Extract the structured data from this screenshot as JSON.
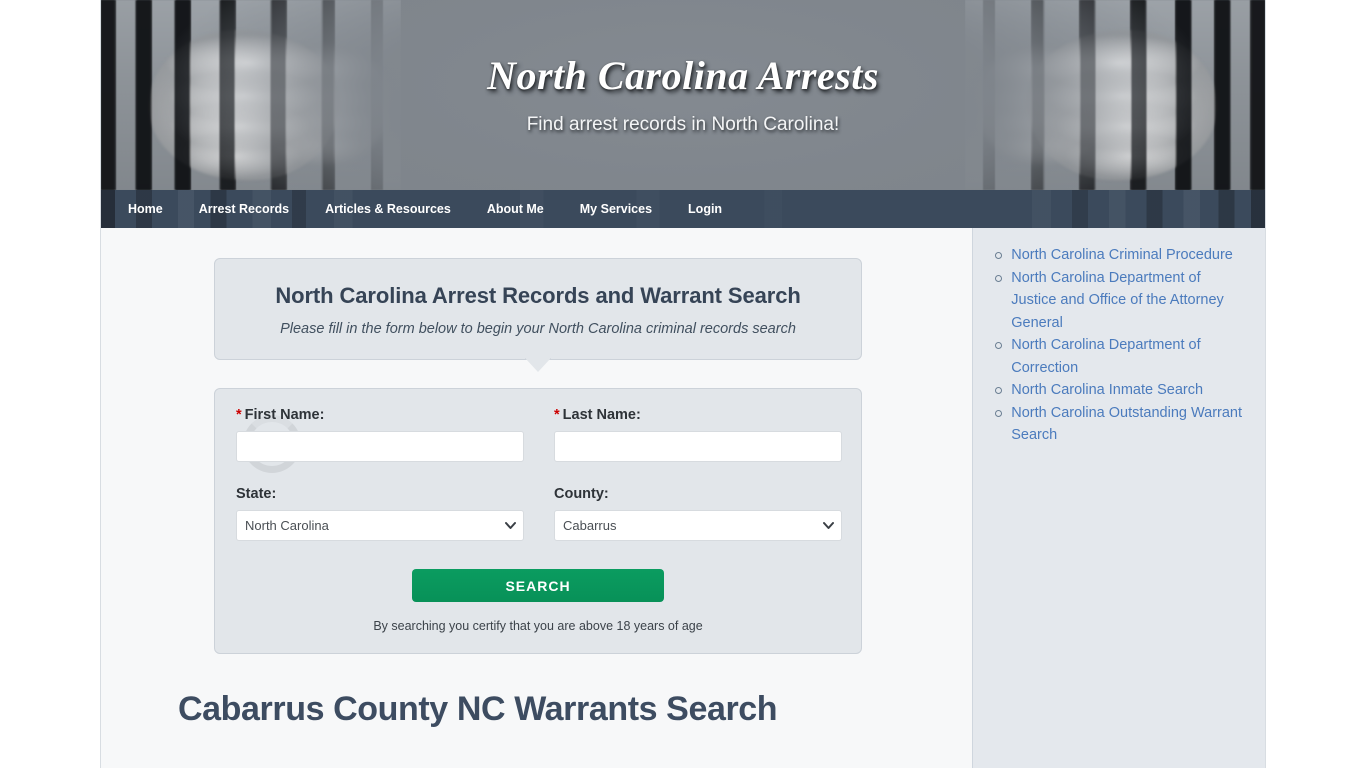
{
  "banner": {
    "title": "North Carolina Arrests",
    "tagline": "Find arrest records in North Carolina!",
    "image_alt": "hands-gripping-prison-bars"
  },
  "nav": {
    "items": [
      {
        "label": "Home"
      },
      {
        "label": "Arrest Records"
      },
      {
        "label": "Articles & Resources"
      },
      {
        "label": "About Me"
      },
      {
        "label": "My Services"
      },
      {
        "label": "Login"
      }
    ]
  },
  "intro": {
    "title": "North Carolina Arrest Records and Warrant Search",
    "subtitle": "Please fill in the form below to begin your North Carolina criminal records search"
  },
  "form": {
    "first_name": {
      "label": "First Name:",
      "required_marker": "*",
      "value": "",
      "placeholder": ""
    },
    "last_name": {
      "label": "Last Name:",
      "required_marker": "*",
      "value": "",
      "placeholder": ""
    },
    "state": {
      "label": "State:",
      "value": "North Carolina",
      "options": [
        "North Carolina"
      ]
    },
    "county": {
      "label": "County:",
      "value": "Cabarrus",
      "options": [
        "Cabarrus"
      ]
    },
    "submit_label": "SEARCH",
    "disclaimer": "By searching you certify that you are above 18 years of age"
  },
  "page": {
    "heading": "Cabarrus County NC Warrants Search"
  },
  "sidebar": {
    "links": [
      {
        "label": "North Carolina Criminal Procedure"
      },
      {
        "label": "North Carolina Department of Justice and Office of the Attorney General"
      },
      {
        "label": "North Carolina Department of Correction"
      },
      {
        "label": "North Carolina Inmate Search"
      },
      {
        "label": "North Carolina Outstanding Warrant Search"
      }
    ]
  },
  "colors": {
    "nav_bar": "#3b4a5c",
    "panel_bg": "#e2e6ea",
    "sidebar_bg": "#e4e8ed",
    "heading_text": "#3d4c61",
    "search_button": "#0a9a5e",
    "required_asterisk": "#cc0000",
    "link_blue": "#4b7bbd",
    "page_bg": "#f7f8f9"
  }
}
